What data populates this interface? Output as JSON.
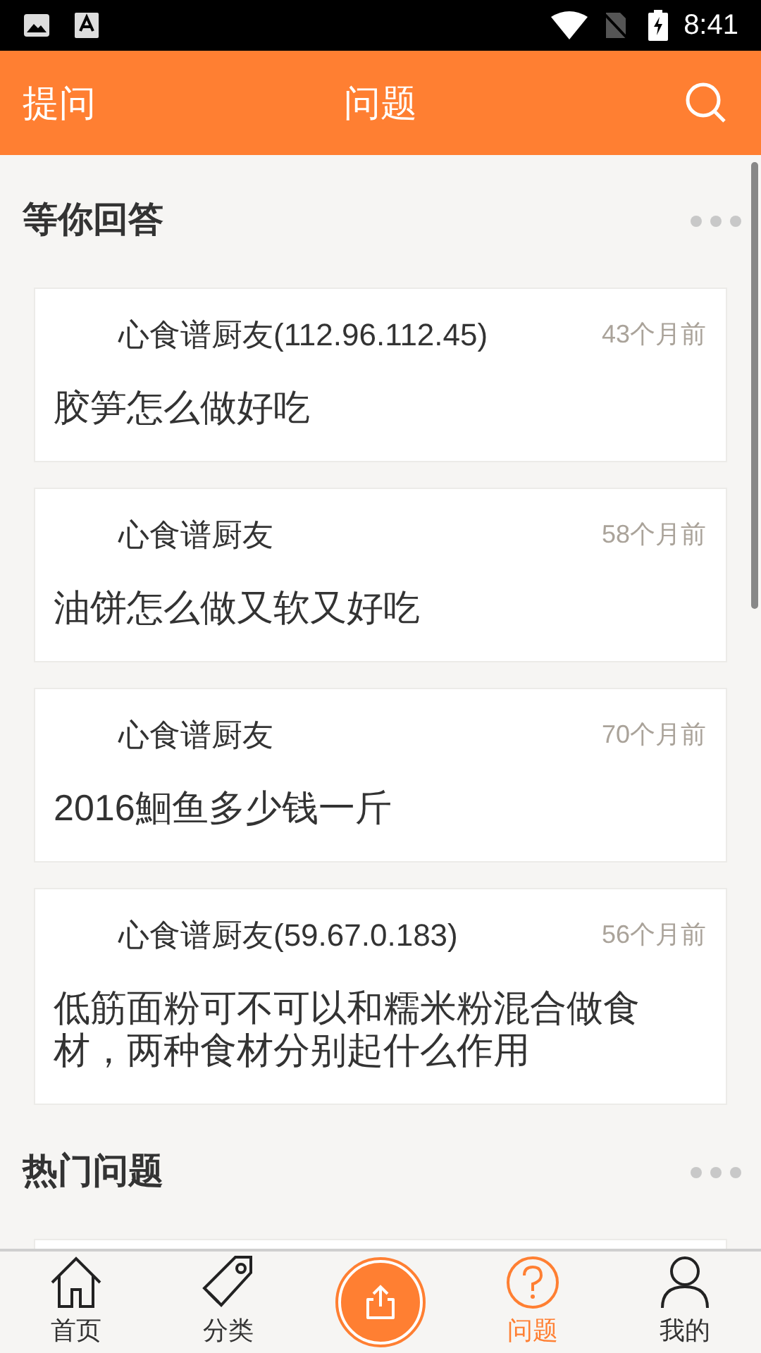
{
  "status_bar": {
    "time": "8:41"
  },
  "header": {
    "left_action": "提问",
    "title": "问题"
  },
  "sections": [
    {
      "title": "等你回答",
      "questions": [
        {
          "author": "心食谱厨友(112.96.112.45)",
          "time": "43个月前",
          "question": "胶笋怎么做好吃"
        },
        {
          "author": "心食谱厨友",
          "time": "58个月前",
          "question": "油饼怎么做又软又好吃"
        },
        {
          "author": "心食谱厨友",
          "time": "70个月前",
          "question": "2016鮰鱼多少钱一斤"
        },
        {
          "author": "心食谱厨友(59.67.0.183)",
          "time": "56个月前",
          "question": "低筋面粉可不可以和糯米粉混合做食材，两种食材分别起什么作用"
        }
      ]
    },
    {
      "title": "热门问题"
    }
  ],
  "bottom_nav": [
    {
      "kind": "home",
      "label": "首页",
      "selected": false
    },
    {
      "kind": "tag",
      "label": "分类",
      "selected": false
    },
    {
      "kind": "upload",
      "selected": false
    },
    {
      "kind": "question",
      "label": "问题",
      "selected": true
    },
    {
      "kind": "user",
      "label": "我的",
      "selected": false
    }
  ]
}
